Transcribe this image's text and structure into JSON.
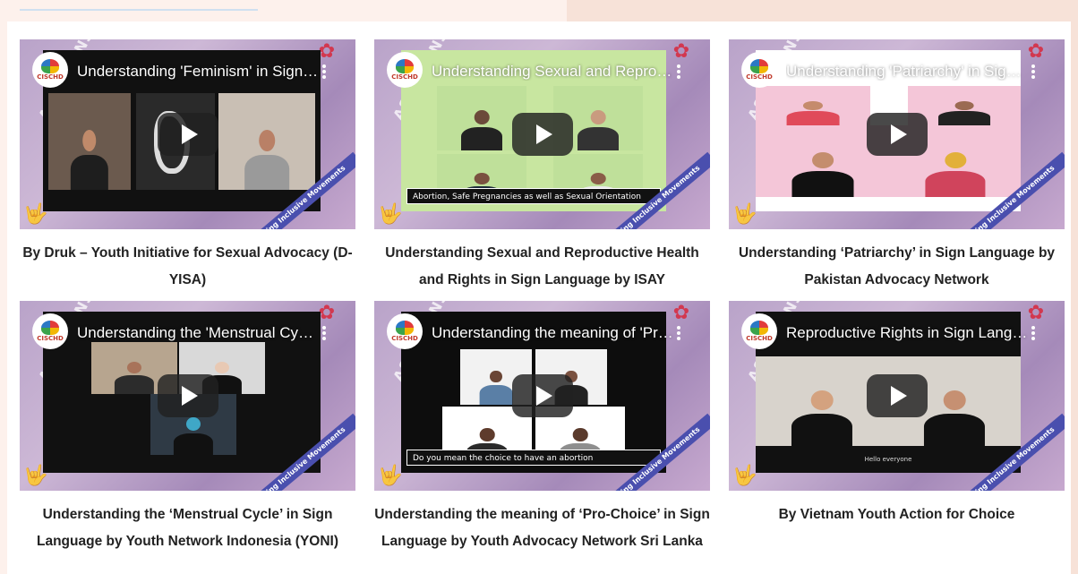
{
  "videos": [
    {
      "title": "Understanding 'Feminism' in Sign Language by Druk – Youth Initiative for Sexual Advocacy",
      "caption": "By Druk – Youth Initiative for Sexual Advocacy (D-YISA)",
      "scene": "feminism"
    },
    {
      "title": "Understanding Sexual and Reproductive Health and Rights in Sign Language by ISAY",
      "caption": "Understanding Sexual and Reproductive Health and Rights in Sign Language by ISAY",
      "scene": "srhr",
      "subtitle": "Abortion, Safe Pregnancies as well as Sexual Orientation"
    },
    {
      "title": "Understanding 'Patriarchy' in Sign Language by Pakistan Advocacy Network",
      "caption": "Understanding ‘Patriarchy’ in Sign Language by Pakistan Advocacy Network",
      "scene": "patriarchy"
    },
    {
      "title": "Understanding the 'Menstrual Cycle' in Sign Language by Youth Network Indonesia",
      "caption": "Understanding the ‘Menstrual Cycle’ in Sign Language by Youth Network Indonesia (YONI)",
      "scene": "menstrual"
    },
    {
      "title": "Understanding the meaning of 'Pro-Choice' in Sign Language",
      "caption": "Understanding the meaning of ‘Pro-Choice’ in Sign Language by Youth Advocacy Network Sri Lanka",
      "scene": "prochoice",
      "subtitle": "Do you mean the choice to have an abortion"
    },
    {
      "title": "Reproductive Rights in Sign Language by Vietnam Youth Action for Choice",
      "caption": "By Vietnam Youth Action for Choice",
      "scene": "reproductive",
      "subtitle": "Hello everyone"
    }
  ],
  "thumbnail": {
    "logo_text": "CISCHD",
    "side_tag": "ASAP CANS",
    "corner_ribbon": "Building Inclusive Movements"
  },
  "icons": {
    "play": "play-icon",
    "menu": "kebab-menu-icon",
    "logo": "channel-logo-icon"
  },
  "colors": {
    "caption_text": "#222222",
    "thumbnail_bg": "#b9a3c9",
    "ribbon": "#4a4fae",
    "play_button": "#212121"
  }
}
